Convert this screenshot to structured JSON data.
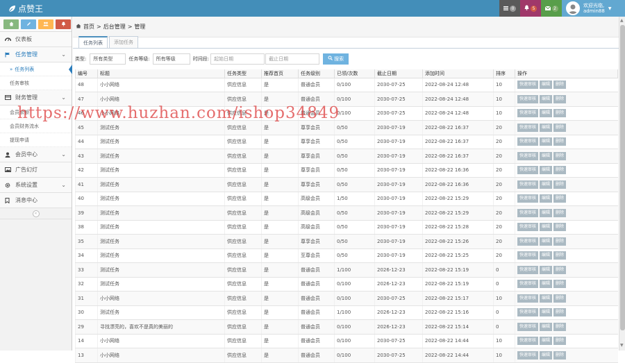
{
  "app": {
    "title": "点赞王"
  },
  "topbar": {
    "badges": [
      {
        "icon": "list-icon",
        "count": "0",
        "color": "#555555",
        "bg": "#5a5a5a"
      },
      {
        "icon": "bell-icon",
        "count": "5",
        "color": "#d15b47",
        "bg": "#a0386a"
      },
      {
        "icon": "envelope-icon",
        "count": "2",
        "color": "#82af6f",
        "bg": "#589e4a"
      }
    ],
    "user": {
      "greeting": "欢迎光临,",
      "name": "admin88"
    }
  },
  "sidebar": {
    "shortcuts": [
      {
        "icon": "signal-icon",
        "color": "#87b87f"
      },
      {
        "icon": "pencil-icon",
        "color": "#6fb3e0"
      },
      {
        "icon": "users-icon",
        "color": "#ffb752"
      },
      {
        "icon": "cogs-icon",
        "color": "#d15b47"
      }
    ],
    "items": [
      {
        "label": "仪表板"
      },
      {
        "label": "任务管理",
        "sub": [
          "任务列表",
          "任务审核"
        ]
      },
      {
        "label": "财务管理",
        "sub": [
          "会员余额",
          "会员财务流水",
          "提现申请"
        ]
      },
      {
        "label": "会员中心"
      },
      {
        "label": "广告幻灯"
      },
      {
        "label": "系统设置"
      },
      {
        "label": "消息中心"
      }
    ]
  },
  "breadcrumb": {
    "home": "首页",
    "sep1": ">",
    "section": "后台管理",
    "sep2": ">",
    "page": "管理"
  },
  "tabs": [
    {
      "label": "任务列表"
    },
    {
      "label": "添加任务"
    }
  ],
  "filter": {
    "type_label": "类型:",
    "type_value": "所有类型",
    "level_label": "任务等级:",
    "level_value": "所有等级",
    "date_label": "时间段:",
    "start_placeholder": "起始日期",
    "end_placeholder": "截止日期",
    "search_label": "搜索"
  },
  "table": {
    "headers": [
      "编号",
      "标题",
      "任务类型",
      "推荐首页",
      "任务级别",
      "已领/次数",
      "截止日期",
      "添加时间",
      "排序",
      "操作"
    ],
    "actions": [
      "快速审核",
      "编辑",
      "删除"
    ],
    "rows": [
      [
        "48",
        "小小网络",
        "供应信息",
        "是",
        "普通会员",
        "0/100",
        "2030-07-25",
        "2022-08-24 12:48",
        "10"
      ],
      [
        "47",
        "小小网络",
        "供应信息",
        "是",
        "普通会员",
        "0/100",
        "2030-07-25",
        "2022-08-24 12:48",
        "10"
      ],
      [
        "46",
        "小小网络",
        "供应信息",
        "是",
        "普通会员",
        "0/100",
        "2030-07-25",
        "2022-08-24 12:48",
        "10"
      ],
      [
        "45",
        "测试任务",
        "供应信息",
        "是",
        "尊享会员",
        "0/50",
        "2030-07-19",
        "2022-08-22 16:37",
        "20"
      ],
      [
        "44",
        "测试任务",
        "供应信息",
        "是",
        "尊享会员",
        "0/50",
        "2030-07-19",
        "2022-08-22 16:37",
        "20"
      ],
      [
        "43",
        "测试任务",
        "供应信息",
        "是",
        "尊享会员",
        "0/50",
        "2030-07-19",
        "2022-08-22 16:37",
        "20"
      ],
      [
        "42",
        "测试任务",
        "供应信息",
        "是",
        "尊享会员",
        "0/50",
        "2030-07-19",
        "2022-08-22 16:36",
        "20"
      ],
      [
        "41",
        "测试任务",
        "供应信息",
        "是",
        "尊享会员",
        "0/50",
        "2030-07-19",
        "2022-08-22 16:36",
        "20"
      ],
      [
        "40",
        "测试任务",
        "供应信息",
        "是",
        "高级会员",
        "1/50",
        "2030-07-19",
        "2022-08-22 15:29",
        "20"
      ],
      [
        "39",
        "测试任务",
        "供应信息",
        "是",
        "高级会员",
        "0/50",
        "2030-07-19",
        "2022-08-22 15:29",
        "20"
      ],
      [
        "38",
        "测试任务",
        "供应信息",
        "是",
        "高级会员",
        "0/50",
        "2030-07-19",
        "2022-08-22 15:28",
        "20"
      ],
      [
        "35",
        "测试任务",
        "供应信息",
        "是",
        "尊享会员",
        "0/50",
        "2030-07-19",
        "2022-08-22 15:26",
        "20"
      ],
      [
        "34",
        "测试任务",
        "供应信息",
        "是",
        "至尊会员",
        "0/50",
        "2030-07-19",
        "2022-08-22 15:25",
        "20"
      ],
      [
        "33",
        "测试任务",
        "供应信息",
        "是",
        "普通会员",
        "1/100",
        "2026-12-23",
        "2022-08-22 15:19",
        "0"
      ],
      [
        "32",
        "测试任务",
        "供应信息",
        "是",
        "普通会员",
        "0/100",
        "2026-12-23",
        "2022-08-22 15:19",
        "0"
      ],
      [
        "31",
        "小小网络",
        "供应信息",
        "是",
        "普通会员",
        "0/100",
        "2030-07-25",
        "2022-08-22 15:17",
        "10"
      ],
      [
        "30",
        "测试任务",
        "供应信息",
        "是",
        "普通会员",
        "1/100",
        "2026-12-23",
        "2022-08-22 15:16",
        "0"
      ],
      [
        "29",
        "寻找漂亮的，喜欢不是真的美丽的",
        "供应信息",
        "是",
        "普通会员",
        "0/100",
        "2026-12-23",
        "2022-08-22 15:14",
        "0"
      ],
      [
        "14",
        "小小网络",
        "供应信息",
        "是",
        "普通会员",
        "0/100",
        "2030-07-25",
        "2022-08-22 14:44",
        "10"
      ],
      [
        "13",
        "小小网络",
        "供应信息",
        "是",
        "普通会员",
        "0/100",
        "2030-07-25",
        "2022-08-22 14:44",
        "10"
      ]
    ]
  },
  "watermark": "https://www.huzhan.com/ishop34849"
}
